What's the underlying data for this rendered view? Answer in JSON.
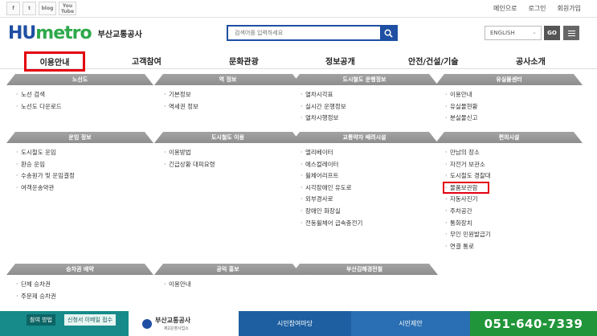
{
  "topbar": {
    "sns": [
      "f",
      "t",
      "blog",
      "You Tube"
    ],
    "links": [
      "메인으로",
      "로그인",
      "회원가입"
    ]
  },
  "header": {
    "logo_text_1": "HU",
    "logo_text_2": "metro",
    "logo_korean": "부산교통공사",
    "search_placeholder": "검색어를 입력하세요",
    "language": "ENGLISH",
    "go_label": "GO"
  },
  "gnb": [
    "이용안내",
    "고객참여",
    "문화관광",
    "정보공개",
    "안전/건설/기술",
    "공사소개"
  ],
  "columns": [
    {
      "title": "노선도",
      "items": [
        "노선 검색",
        "노선도 다운로드"
      ]
    },
    {
      "title": "역 정보",
      "items": [
        "기본정보",
        "역세권 정보"
      ]
    },
    {
      "title": "도시철도 운행정보",
      "items": [
        "열차시각표",
        "실시간 운행정보",
        "열차시행정보"
      ]
    },
    {
      "title": "유실물센터",
      "items": [
        "이용안내",
        "유실물현황",
        "분실물신고"
      ]
    },
    {
      "title": "운임 정보",
      "items": [
        "도시철도 운임",
        "환승 운임",
        "수송원가 및 운임결정",
        "여객운송약관"
      ]
    },
    {
      "title": "도시철도 이용",
      "items": [
        "이용방법",
        "긴급상황 대피요령"
      ]
    },
    {
      "title": "교통약자 배려시설",
      "items": [
        "엘리베이터",
        "에스컬레이터",
        "휠체어리프트",
        "시각장애인 유도로",
        "외부경사로",
        "장애인 화장실",
        "전동휠체어 급속충전기"
      ]
    },
    {
      "title": "편의시설",
      "items": [
        "만남의 장소",
        "자전거 보관소",
        "도시철도 경찰대",
        "물품보관함",
        "자동사진기",
        "주차공간",
        "통화장치",
        "무인 민원발급기",
        "연결 통로"
      ]
    },
    {
      "title": "승차권 예약",
      "items": [
        "단체 승차권",
        "주문제 승차권"
      ]
    },
    {
      "title": "공익 홍보",
      "items": [
        "이용안내"
      ]
    },
    {
      "title": "부산김해경전철",
      "items": []
    }
  ],
  "banner": {
    "tag1": "참여 방법",
    "tag2": "신청서 이메일 접수",
    "org": "부산교통공사",
    "org_sub": "제2운영사업소",
    "b3": "시민참여마당",
    "b4": "시민제안",
    "phone": "051-640-7339"
  },
  "colors": {
    "brand_blue": "#1e4fa3",
    "highlight_red": "#e3000f",
    "header_gray": "#999999"
  }
}
